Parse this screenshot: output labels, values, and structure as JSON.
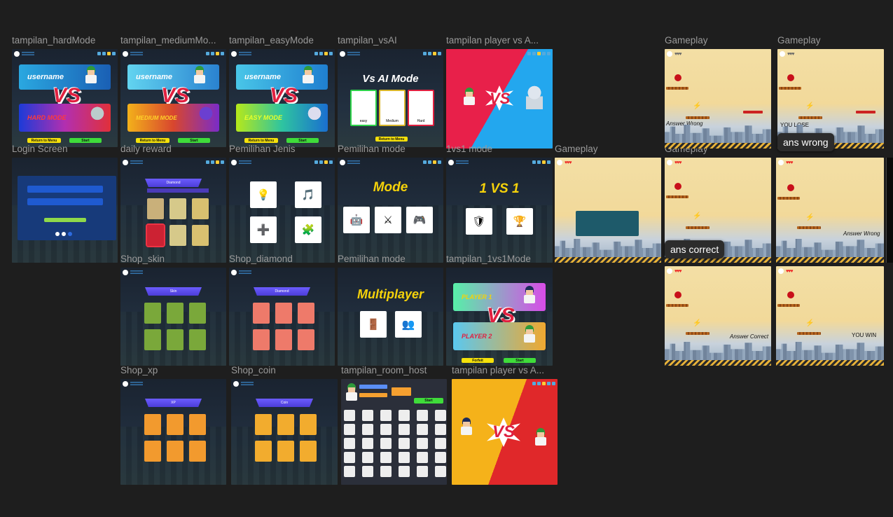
{
  "frames": {
    "hardMode": {
      "label": "tampilan_hardMode",
      "username": "username",
      "mode": "HARD MODE",
      "return": "Return to Menu",
      "start": "Start",
      "vs": "VS"
    },
    "mediumMode": {
      "label": "tampilan_mediumMo...",
      "username": "username",
      "mode": "MEDIUM MODE",
      "return": "Return to Menu",
      "start": "Start",
      "vs": "VS"
    },
    "easyMode": {
      "label": "tampilan_easyMode",
      "username": "username",
      "mode": "EASY MODE",
      "return": "Return to Menu",
      "start": "Start",
      "vs": "VS"
    },
    "vsAI": {
      "label": "tampilan_vsAI",
      "title": "Vs AI Mode",
      "options": [
        "easy",
        "Medium",
        "Hard"
      ],
      "return": "Return to Menu"
    },
    "playerVsAI1": {
      "label": "tampilan player vs A...",
      "vs": "VS"
    },
    "loginScreen": {
      "label": "Login Screen"
    },
    "dailyReward": {
      "label": "daily reward",
      "title": "Diamond"
    },
    "pemilihanJenis": {
      "label": "Pemilihan Jenis"
    },
    "pemilihanMode1": {
      "label": "Pemilihan mode",
      "title": "Mode"
    },
    "oneVsOneMode": {
      "label": "1vs1 mode",
      "title": "1 VS 1"
    },
    "shopSkin": {
      "label": "Shop_skin",
      "title": "Skin"
    },
    "shopDiamond": {
      "label": "Shop_diamond",
      "title": "Diamond"
    },
    "pemilihanMode2": {
      "label": "Pemilihan mode",
      "title": "Multiplayer"
    },
    "tampilan1vs1": {
      "label": "tampilan_1vs1Mode",
      "player1": "PLAYER 1",
      "player2": "PLAYER 2",
      "forfeit": "Forfeit",
      "start": "Start",
      "vs": "VS"
    },
    "shopXp": {
      "label": "Shop_xp",
      "title": "XP"
    },
    "shopCoin": {
      "label": "Shop_coin",
      "title": "Coin"
    },
    "roomHost": {
      "label": "tampilan_room_host",
      "start": "Start"
    },
    "playerVsAI2": {
      "label": "tampilan player vs A...",
      "vs": "VS"
    },
    "gameplayMid": {
      "label": "Gameplay"
    },
    "gameplay1": {
      "label": "Gameplay",
      "msg": "Answer Wrong"
    },
    "gameplay2": {
      "label": "Gameplay",
      "msg": "YOU LOSE"
    },
    "gameplay3": {
      "label": "Gameplay"
    },
    "gameplay4": {
      "msg": "Answer Wrong"
    },
    "gameplay5": {
      "msg": "Answer Correct"
    },
    "gameplay6": {
      "msg": "YOU WIN"
    }
  },
  "tooltips": {
    "wrong": "ans wrong",
    "correct": "ans correct"
  },
  "colors": {
    "canvas": "#1e1e1e",
    "label": "#9a9a9a",
    "accent_red": "#e02040",
    "accent_yellow": "#f5d20a"
  }
}
